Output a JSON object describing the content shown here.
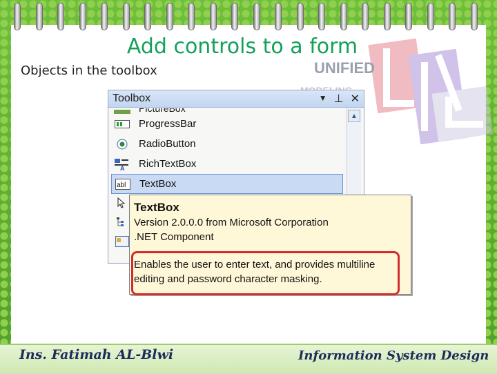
{
  "slide": {
    "title": "Add controls to a form",
    "subtitle": "Objects in the toolbox"
  },
  "logo": {
    "letters": "UML",
    "line1": "UNIFIED",
    "line2": "MODELING"
  },
  "toolbox": {
    "title": "Toolbox",
    "controls": {
      "dropdown": "▼",
      "pin": "⊥",
      "close": "✕"
    },
    "partial_item": "PictureBox",
    "items": [
      {
        "label": "ProgressBar",
        "icon": "progressbar-icon"
      },
      {
        "label": "RadioButton",
        "icon": "radiobutton-icon"
      },
      {
        "label": "RichTextBox",
        "icon": "richtextbox-icon"
      },
      {
        "label": "TextBox",
        "icon": "textbox-icon",
        "selected": true
      }
    ]
  },
  "tooltip": {
    "name": "TextBox",
    "version": "Version 2.0.0.0 from Microsoft Corporation",
    "component": ".NET Component",
    "description": "Enables the user to enter text, and provides multiline editing and password character masking."
  },
  "footer": {
    "author": "Ins. Fatimah AL-Blwi",
    "course": "Information System Design"
  },
  "colors": {
    "title": "#14a05a",
    "highlight": "#d12c2c",
    "selection": "#c9daf4",
    "tooltip_bg": "#fff8d8"
  }
}
